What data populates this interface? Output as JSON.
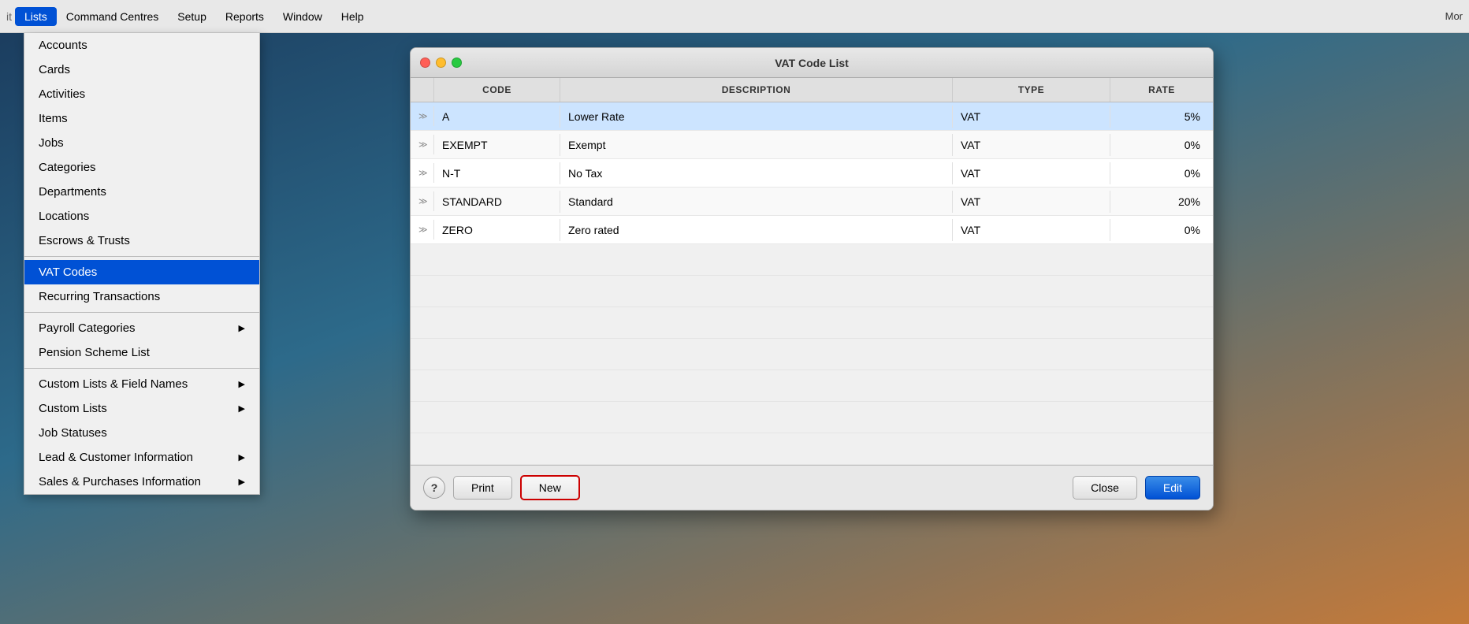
{
  "menuBar": {
    "editLabel": "it",
    "items": [
      {
        "id": "lists",
        "label": "Lists",
        "active": true
      },
      {
        "id": "command-centres",
        "label": "Command Centres",
        "active": false
      },
      {
        "id": "setup",
        "label": "Setup",
        "active": false
      },
      {
        "id": "reports",
        "label": "Reports",
        "active": false
      },
      {
        "id": "window",
        "label": "Window",
        "active": false
      },
      {
        "id": "help",
        "label": "Help",
        "active": false
      }
    ],
    "rightItems": [
      "Mor"
    ]
  },
  "dropdown": {
    "items": [
      {
        "id": "accounts",
        "label": "Accounts",
        "arrow": false,
        "selected": false,
        "gap": false
      },
      {
        "id": "cards",
        "label": "Cards",
        "arrow": false,
        "selected": false,
        "gap": false
      },
      {
        "id": "activities",
        "label": "Activities",
        "arrow": false,
        "selected": false,
        "gap": false
      },
      {
        "id": "items",
        "label": "Items",
        "arrow": false,
        "selected": false,
        "gap": false
      },
      {
        "id": "jobs",
        "label": "Jobs",
        "arrow": false,
        "selected": false,
        "gap": false
      },
      {
        "id": "categories",
        "label": "Categories",
        "arrow": false,
        "selected": false,
        "gap": false
      },
      {
        "id": "departments",
        "label": "Departments",
        "arrow": false,
        "selected": false,
        "gap": false
      },
      {
        "id": "locations",
        "label": "Locations",
        "arrow": false,
        "selected": false,
        "gap": false
      },
      {
        "id": "escrows",
        "label": "Escrows & Trusts",
        "arrow": false,
        "selected": false,
        "gap": false
      },
      {
        "id": "vat-codes",
        "label": "VAT Codes",
        "arrow": false,
        "selected": true,
        "gap": true
      },
      {
        "id": "recurring",
        "label": "Recurring Transactions",
        "arrow": false,
        "selected": false,
        "gap": false
      },
      {
        "id": "payroll-categories",
        "label": "Payroll Categories",
        "arrow": true,
        "selected": false,
        "gap": true
      },
      {
        "id": "pension",
        "label": "Pension Scheme List",
        "arrow": false,
        "selected": false,
        "gap": false
      },
      {
        "id": "custom-lists-field",
        "label": "Custom Lists & Field Names",
        "arrow": true,
        "selected": false,
        "gap": true
      },
      {
        "id": "custom-lists",
        "label": "Custom Lists",
        "arrow": true,
        "selected": false,
        "gap": false
      },
      {
        "id": "job-statuses",
        "label": "Job Statuses",
        "arrow": false,
        "selected": false,
        "gap": false
      },
      {
        "id": "lead-customer",
        "label": "Lead & Customer Information",
        "arrow": true,
        "selected": false,
        "gap": false
      },
      {
        "id": "sales-purchases",
        "label": "Sales & Purchases Information",
        "arrow": true,
        "selected": false,
        "gap": false
      }
    ]
  },
  "window": {
    "title": "VAT Code List",
    "table": {
      "columns": [
        "",
        "CODE",
        "DESCRIPTION",
        "TYPE",
        "RATE"
      ],
      "rows": [
        {
          "arrow": "≫",
          "code": "A",
          "description": "Lower Rate",
          "type": "VAT",
          "rate": "5%",
          "highlighted": true
        },
        {
          "arrow": "≫",
          "code": "EXEMPT",
          "description": "Exempt",
          "type": "VAT",
          "rate": "0%",
          "highlighted": false
        },
        {
          "arrow": "≫",
          "code": "N-T",
          "description": "No Tax",
          "type": "VAT",
          "rate": "0%",
          "highlighted": false
        },
        {
          "arrow": "≫",
          "code": "STANDARD",
          "description": "Standard",
          "type": "VAT",
          "rate": "20%",
          "highlighted": false
        },
        {
          "arrow": "≫",
          "code": "ZERO",
          "description": "Zero rated",
          "type": "VAT",
          "rate": "0%",
          "highlighted": false
        }
      ]
    },
    "footer": {
      "helpLabel": "?",
      "printLabel": "Print",
      "newLabel": "New",
      "closeLabel": "Close",
      "editLabel": "Edit"
    }
  }
}
